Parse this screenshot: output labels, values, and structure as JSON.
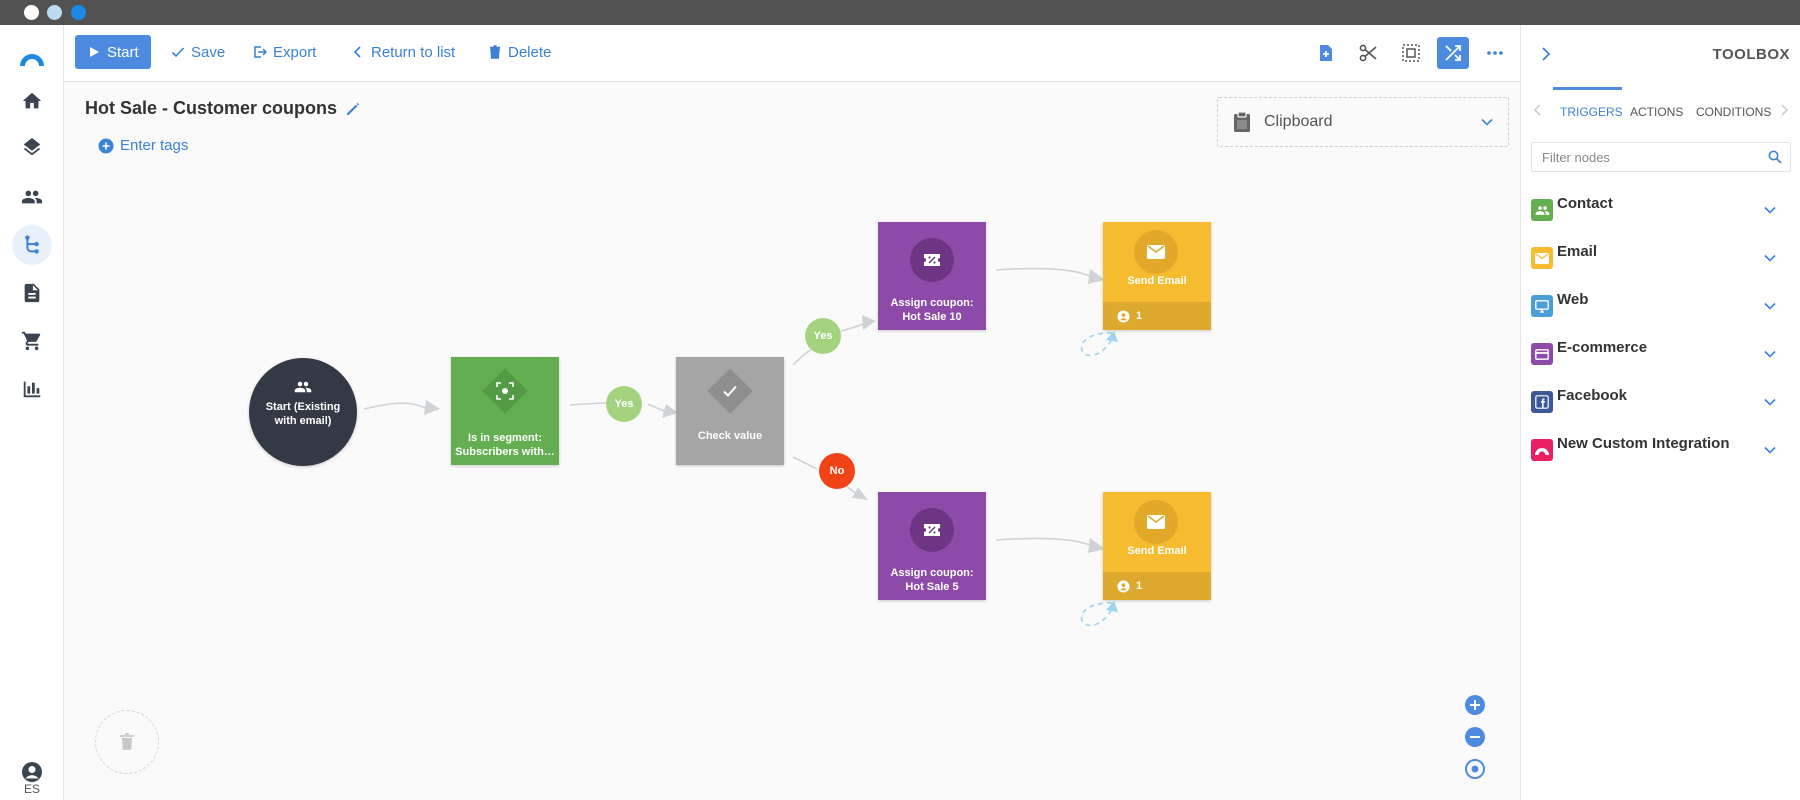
{
  "window": {
    "dot_colors": [
      "#ffffff",
      "#b9dcf3",
      "#1e88e5"
    ]
  },
  "nav": {
    "items": [
      "home-icon",
      "layers-icon",
      "contacts-icon",
      "automation-icon",
      "document-icon",
      "cart-icon",
      "chart-icon"
    ],
    "active": "automation-icon",
    "language": "ES"
  },
  "toolbar": {
    "start_label": "Start",
    "save_label": "Save",
    "export_label": "Export",
    "return_label": "Return to list",
    "delete_label": "Delete"
  },
  "flow": {
    "title": "Hot Sale - Customer coupons",
    "tags_label": "Enter tags",
    "clipboard_label": "Clipboard"
  },
  "nodes": {
    "start": "Start (Existing with email)",
    "segment": "Is in segment: Subscribers with…",
    "check": "Check value",
    "coupon_top": "Assign coupon: Hot Sale 10",
    "coupon_bottom": "Assign coupon: Hot Sale 5",
    "email_top": "Send Email",
    "email_top_count": "1",
    "email_bottom": "Send Email",
    "email_bottom_count": "1"
  },
  "badges": {
    "yes_1": "Yes",
    "yes_2": "Yes",
    "no": "No"
  },
  "toolbox": {
    "title": "TOOLBOX",
    "tabs": [
      "TRIGGERS",
      "ACTIONS",
      "CONDITIONS"
    ],
    "active_tab": "TRIGGERS",
    "filter_placeholder": "Filter nodes",
    "categories": [
      {
        "label": "Contact",
        "color": "#62ae51"
      },
      {
        "label": "Email",
        "color": "#f6bb2f"
      },
      {
        "label": "Web",
        "color": "#4a9fd8"
      },
      {
        "label": "E-commerce",
        "color": "#8e4aa9"
      },
      {
        "label": "Facebook",
        "color": "#3b5998"
      },
      {
        "label": "New Custom Integration",
        "color": "#e91e63"
      }
    ]
  },
  "colors": {
    "accent": "#4d8be0",
    "start_node": "#343a45",
    "condition_node": "#62ae51",
    "check_node": "#a5a5a5",
    "coupon_node": "#8e4aa9",
    "email_node": "#f6bb2f",
    "yes_badge": "#a4d37f",
    "no_badge": "#f24316"
  }
}
